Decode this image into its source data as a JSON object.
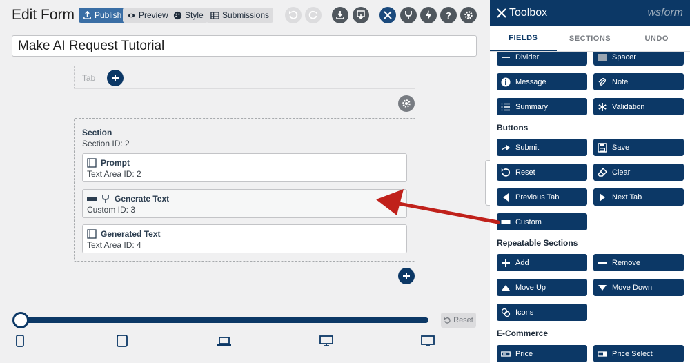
{
  "header": {
    "title": "Edit Form",
    "publish_label": "Publish",
    "preview_label": "Preview",
    "style_label": "Style",
    "submissions_label": "Submissions"
  },
  "form": {
    "name": "Make AI Request Tutorial",
    "tab_label": "Tab",
    "section": {
      "title": "Section",
      "meta": "Section  ID: 2",
      "fields": [
        {
          "label": "Prompt",
          "meta": "Text Area  ID: 2"
        },
        {
          "label": "Generate Text",
          "meta": "Custom  ID: 3"
        },
        {
          "label": "Generated Text",
          "meta": "Text Area  ID: 4"
        }
      ]
    }
  },
  "preview": {
    "reset_label": "Reset",
    "devices": [
      "mobile-icon",
      "tablet-icon",
      "laptop-icon",
      "desktop-icon",
      "large-desktop-icon"
    ],
    "width_fraction": 1.0
  },
  "toolbox": {
    "title": "Toolbox",
    "logo": "wsform",
    "tabs": [
      "FIELDS",
      "SECTIONS",
      "UNDO"
    ],
    "active_tab": "FIELDS",
    "items": {
      "divider": "Divider",
      "spacer": "Spacer",
      "message": "Message",
      "note": "Note",
      "summary": "Summary",
      "validation": "Validation",
      "submit": "Submit",
      "save": "Save",
      "reset": "Reset",
      "clear": "Clear",
      "previous_tab": "Previous Tab",
      "next_tab": "Next Tab",
      "custom": "Custom",
      "add": "Add",
      "remove": "Remove",
      "move_up": "Move Up",
      "move_down": "Move Down",
      "icons": "Icons",
      "price": "Price",
      "price_select": "Price Select"
    },
    "groups": {
      "buttons": "Buttons",
      "repeatable": "Repeatable Sections",
      "ecommerce": "E-Commerce"
    }
  },
  "colors": {
    "navy": "#0c3866",
    "publish_blue": "#3a6ea5",
    "arrow_red": "#c0211b"
  }
}
